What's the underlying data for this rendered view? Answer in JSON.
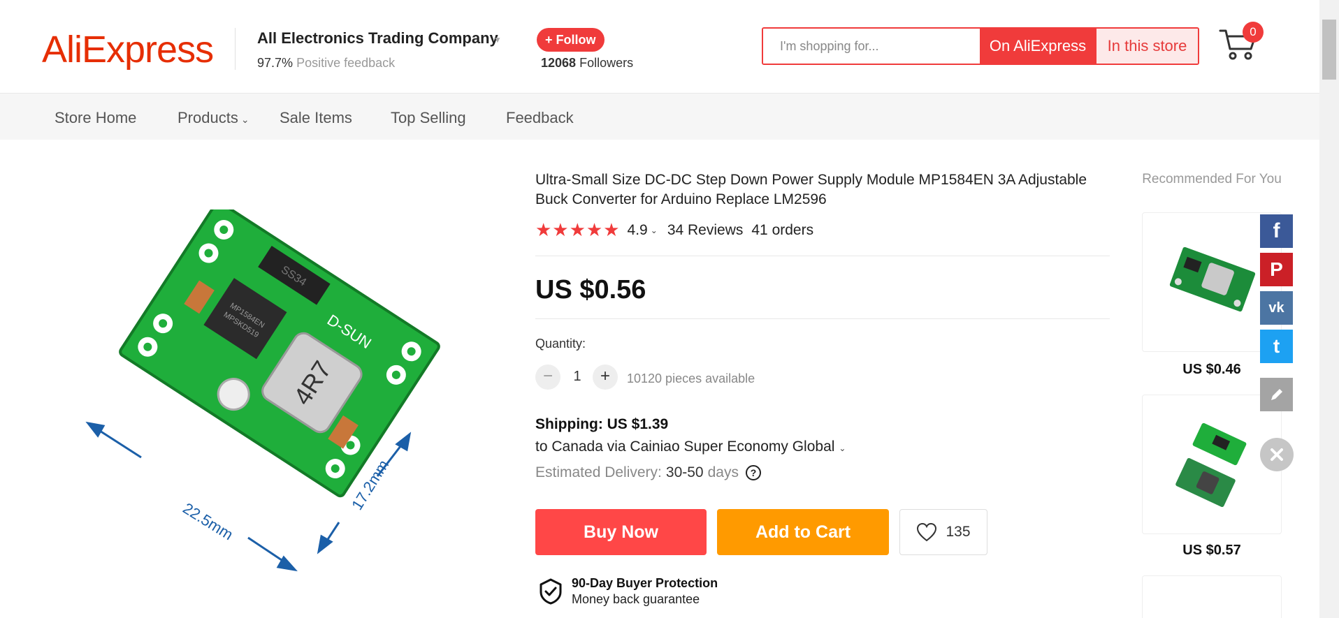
{
  "header": {
    "logo": "AliExpress",
    "store_name": "All Electronics Trading Company",
    "feedback_pct": "97.7%",
    "feedback_label": "Positive feedback",
    "follow_label": "+ Follow",
    "followers_count": "12068",
    "followers_label": "Followers",
    "search_placeholder": "I'm shopping for...",
    "search_btn_ali": "On AliExpress",
    "search_btn_store": "In this store",
    "cart_count": "0"
  },
  "nav": {
    "items": [
      "Store Home",
      "Products",
      "Sale Items",
      "Top Selling",
      "Feedback"
    ]
  },
  "product": {
    "title": "Ultra-Small Size DC-DC Step Down Power Supply Module MP1584EN 3A Adjustable Buck Converter for Arduino Replace LM2596",
    "stars": "★★★★★",
    "rating": "4.9",
    "reviews": "34 Reviews",
    "orders": "41 orders",
    "price": "US $0.56",
    "quantity_label": "Quantity:",
    "quantity": "1",
    "available": "10120 pieces available",
    "shipping_title": "Shipping: US $1.39",
    "shipping_to": "to Canada via Cainiao Super Economy Global",
    "delivery_label": "Estimated Delivery:",
    "delivery_range": "30-50",
    "delivery_unit": "days",
    "buy_now": "Buy Now",
    "add_to_cart": "Add to Cart",
    "wishlist_count": "135",
    "protection_title": "90-Day Buyer Protection",
    "protection_sub": "Money back guarantee",
    "image_labels": {
      "chip_top": "SS34",
      "brand": "D-SUN",
      "inductor": "4R7",
      "ic_line1": "MP1584EN",
      "ic_line2": "MPSKD519",
      "width": "22.5mm",
      "height": "17.2mm"
    }
  },
  "recommended": {
    "title": "Recommended For You",
    "items": [
      {
        "price": "US $0.46"
      },
      {
        "price": "US $0.57"
      }
    ]
  },
  "social": {
    "facebook": "f",
    "pinterest": "P",
    "vk": "vk",
    "twitter": "t"
  },
  "colors": {
    "brand_red": "#f03b3b",
    "buy_red": "#ff4747",
    "cart_orange": "#ff9a00",
    "facebook": "#3b5998",
    "pinterest": "#cb2027",
    "vk": "#4c75a3",
    "twitter": "#1da1f2"
  }
}
